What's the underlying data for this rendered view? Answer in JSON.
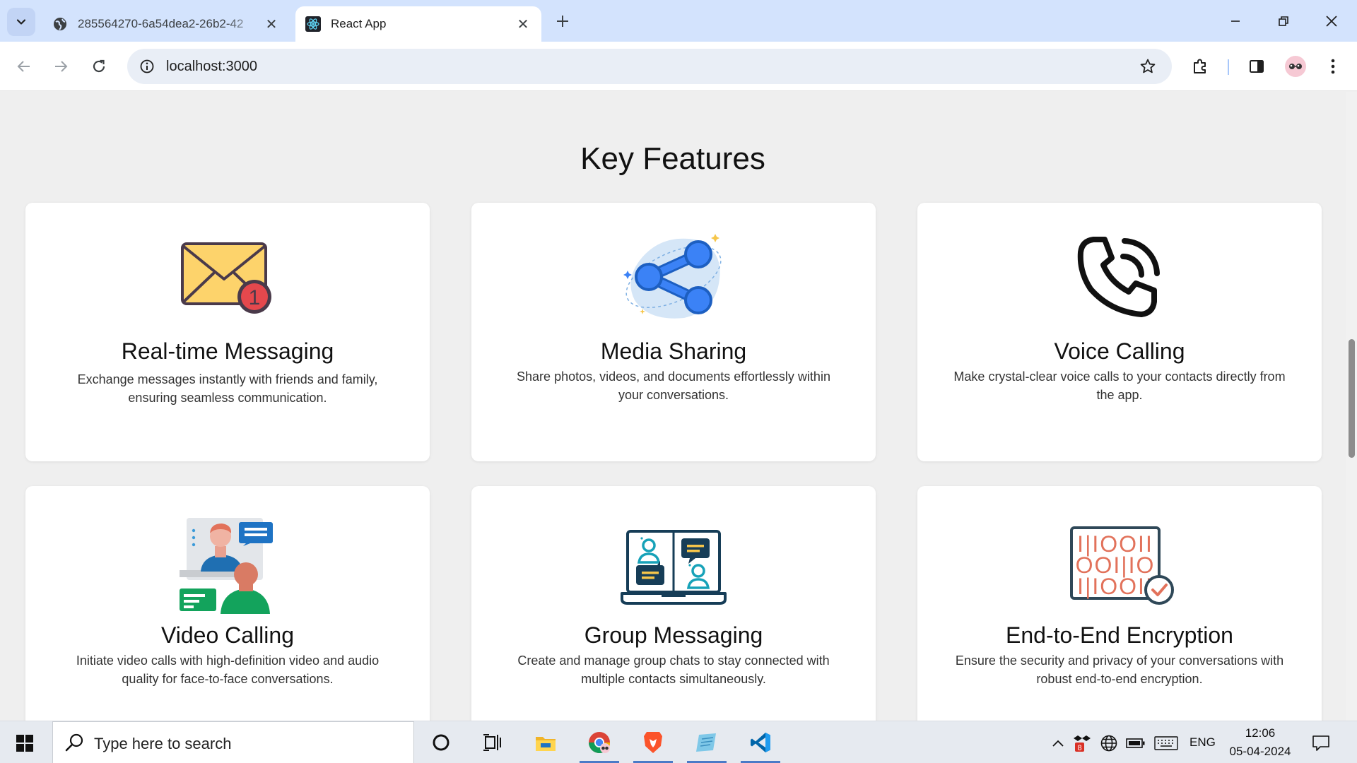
{
  "browser": {
    "tabs": [
      {
        "title": "285564270-6a54dea2-26b2-42",
        "active": false
      },
      {
        "title": "React App",
        "active": true
      }
    ],
    "address": "localhost:3000"
  },
  "page": {
    "section_title": "Key Features",
    "features": [
      {
        "title": "Real-time Messaging",
        "description": "Exchange messages instantly with friends and family, ensuring seamless communication.",
        "icon": "envelope-notification-icon",
        "badge": "1"
      },
      {
        "title": "Media Sharing",
        "description": "Share photos, videos, and documents effortlessly within your conversations.",
        "icon": "share-icon"
      },
      {
        "title": "Voice Calling",
        "description": "Make crystal-clear voice calls to your contacts directly from the app.",
        "icon": "phone-call-icon"
      },
      {
        "title": "Video Calling",
        "description": "Initiate video calls with high-definition video and audio quality for face-to-face conversations.",
        "icon": "video-call-illustration"
      },
      {
        "title": "Group Messaging",
        "description": "Create and manage group chats to stay connected with multiple contacts simultaneously.",
        "icon": "laptop-group-chat-icon"
      },
      {
        "title": "End-to-End Encryption",
        "description": "Ensure the security and privacy of your conversations with robust end-to-end encryption.",
        "icon": "binary-encryption-icon",
        "binary_rows": [
          "I|IOOII",
          "OOI|IO",
          "I|IOOII"
        ]
      }
    ]
  },
  "taskbar": {
    "search_placeholder": "Type here to search",
    "language": "ENG",
    "time": "12:06",
    "date": "05-04-2024",
    "tray_badge": "8"
  },
  "colors": {
    "tabstrip": "#d3e3fd",
    "page_bg": "#efefef",
    "accent_blue": "#3b82f6",
    "envelope_yellow": "#fdd36b",
    "badge_red": "#e5484d",
    "group_teal": "#17a2b8",
    "encrypt_red": "#e2725b"
  }
}
